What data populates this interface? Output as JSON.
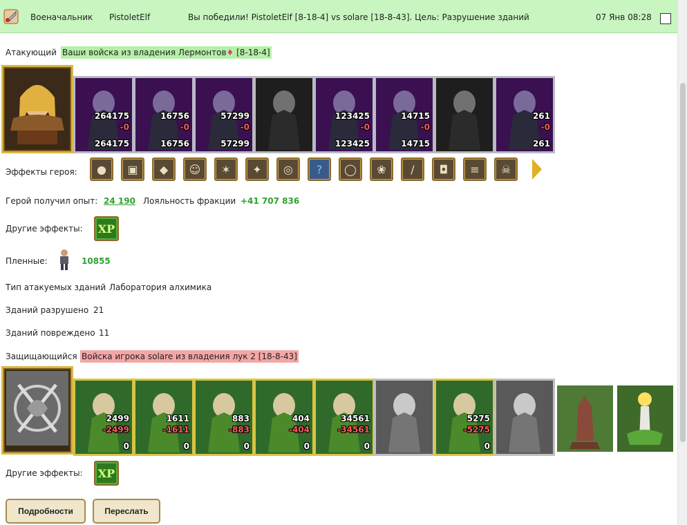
{
  "header": {
    "role": "Военачальник",
    "player": "PistoletElf",
    "message": "Вы победили! PistoletElf [8-18-4] vs solare [18-8-43]. Цель: Разрушение зданий",
    "timestamp": "07 Янв 08:28"
  },
  "attacker": {
    "label": "Атакующий",
    "source_prefix": "Ваши войска из владения Лермонтов",
    "source_suffix": "[8-18-4]",
    "units": [
      {
        "icon": "beast-rider-unit",
        "count": "264175",
        "lost": "-0",
        "left": "264175"
      },
      {
        "icon": "skeleton-warrior-unit",
        "count": "16756",
        "lost": "-0",
        "left": "16756"
      },
      {
        "icon": "death-knight-unit",
        "count": "57299",
        "lost": "-0",
        "left": "57299"
      },
      {
        "icon": "bone-dragon-unit",
        "count": "",
        "lost": "",
        "left": ""
      },
      {
        "icon": "lich-lord-unit",
        "count": "123425",
        "lost": "-0",
        "left": "123425"
      },
      {
        "icon": "banshee-unit",
        "count": "14715",
        "lost": "-0",
        "left": "14715"
      },
      {
        "icon": "reaper-unit",
        "count": "",
        "lost": "",
        "left": ""
      },
      {
        "icon": "dark-mage-unit",
        "count": "261",
        "lost": "-0",
        "left": "261"
      }
    ],
    "effects_label": "Эффекты героя:",
    "effects": [
      "food-icon",
      "armor-icon",
      "crystal-icon",
      "mask-icon",
      "web-icon",
      "rune-icon",
      "ring-icon",
      "question-icon",
      "mirror-icon",
      "pendant-icon",
      "blade-icon",
      "shield-icon",
      "scroll-icon",
      "skull-icon"
    ],
    "exp_label": "Герой получил опыт:",
    "exp_value": "24 190",
    "loyalty_label": "Лояльность фракции",
    "loyalty_value": "+41 707 836",
    "other_label": "Другие эффекты:",
    "xp_badge": "XP",
    "prisoners_label": "Пленные:",
    "prisoners_value": "10855"
  },
  "buildings": {
    "type_label": "Тип атакуемых зданий",
    "type_value": "Лаборатория алхимика",
    "destroyed_label": "Зданий разрушено",
    "destroyed_value": "21",
    "damaged_label": "Зданий повреждено",
    "damaged_value": "11"
  },
  "defender": {
    "label": "Защищающийся",
    "source": "Войска игрока solare из владения лук 2 [18-8-43]",
    "units": [
      {
        "icon": "dwarf-warrior-unit",
        "count": "2499",
        "lost": "-2499",
        "left": "0"
      },
      {
        "icon": "elf-swordsman-unit",
        "count": "1611",
        "lost": "-1611",
        "left": "0"
      },
      {
        "icon": "paladin-unit",
        "count": "883",
        "lost": "-883",
        "left": "0"
      },
      {
        "icon": "griffin-unit",
        "count": "404",
        "lost": "-404",
        "left": "0"
      },
      {
        "icon": "elf-archer-unit",
        "count": "34561",
        "lost": "-34561",
        "left": "0"
      },
      {
        "icon": "ghost-unit",
        "count": "",
        "lost": "",
        "left": ""
      },
      {
        "icon": "druid-unit",
        "count": "5275",
        "lost": "-5275",
        "left": "0"
      },
      {
        "icon": "ghost-unit-2",
        "count": "",
        "lost": "",
        "left": ""
      }
    ],
    "buildings": [
      "tower-building-icon",
      "crystal-tower-building-icon"
    ],
    "other_label": "Другие эффекты:",
    "xp_badge": "XP"
  },
  "buttons": {
    "details": "Подробности",
    "forward": "Переслать"
  },
  "colors": {
    "header_bg": "#c8f5c0",
    "attacker_hl": "#b6f0a8",
    "defender_hl": "#f4a6a6",
    "value_green": "#2da22d",
    "loss_red": "#ff5b5b"
  }
}
